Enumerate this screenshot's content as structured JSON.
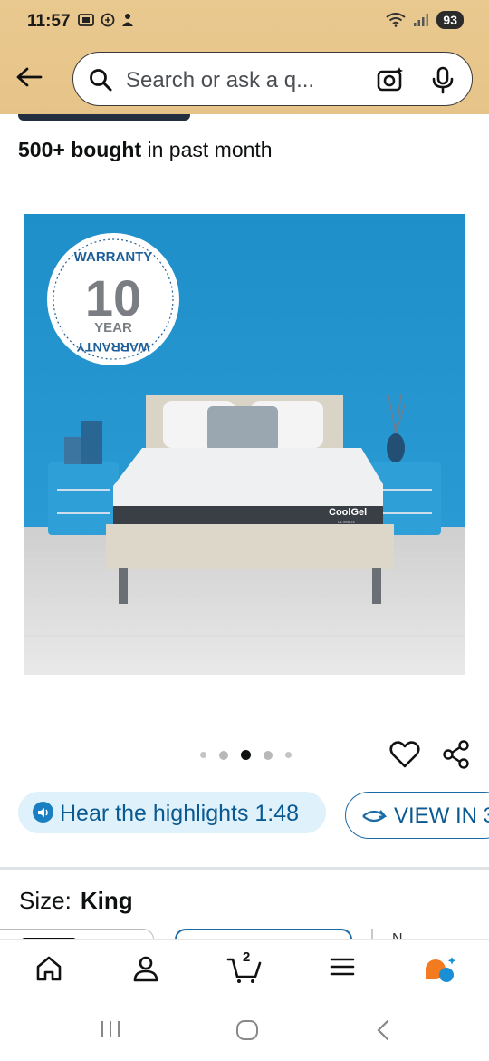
{
  "status_bar": {
    "time": "11:57",
    "battery": "93"
  },
  "search": {
    "placeholder": "Search or ask a q..."
  },
  "product": {
    "bought_bold": "500+ bought",
    "bought_rest": " in past month",
    "image": {
      "badge_top": "WARRANTY",
      "badge_number": "10",
      "badge_unit": "YEAR",
      "badge_bottom": "WARRANTY",
      "brand": "CoolGel",
      "brand_sub": "ULTIMATE"
    },
    "carousel": {
      "count": 5,
      "active_index": 2
    }
  },
  "actions": {
    "hear_label": "Hear the highlights 1:48",
    "view_label": "VIEW IN 3"
  },
  "size": {
    "label": "Size:",
    "value": "King",
    "next_option_partial": "N"
  },
  "bottom_nav": {
    "cart_count": "2"
  },
  "colors": {
    "header_bg": "#e9c98f",
    "accent_blue": "#0a5a91",
    "pill_bg": "#dff1fb",
    "alexa_orange": "#f47a1f",
    "alexa_blue": "#1a8fd6"
  }
}
